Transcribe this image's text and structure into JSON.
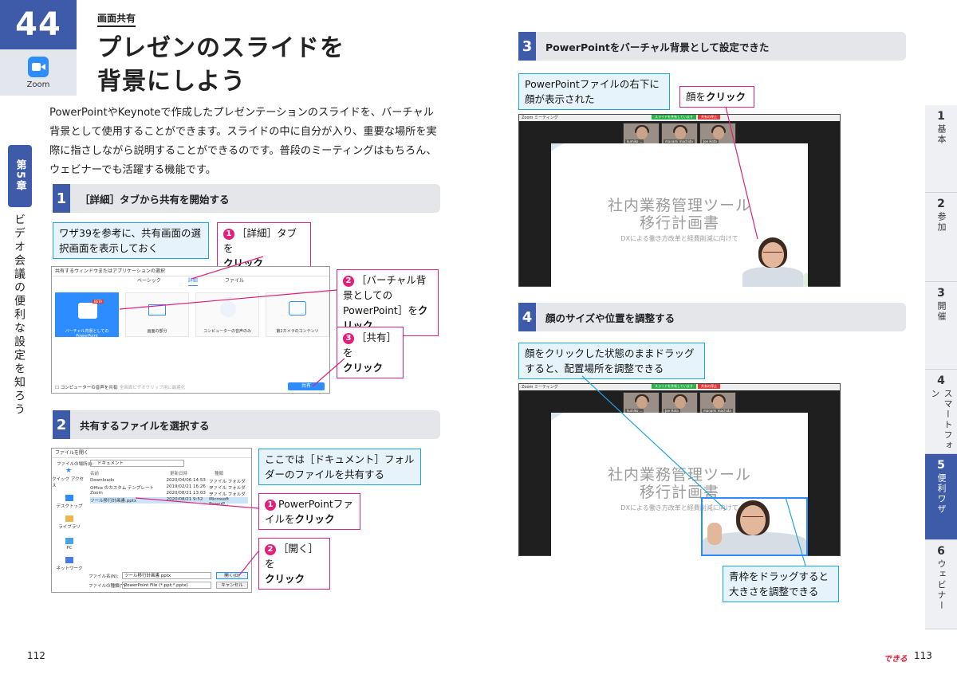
{
  "header": {
    "number": "44",
    "app_label": "Zoom",
    "category": "画面共有",
    "title_line1": "プレゼンのスライドを",
    "title_line2": "背景にしよう"
  },
  "intro": "PowerPointやKeynoteで作成したプレゼンテーションのスライドを、バーチャル背景として使用することができます。スライドの中に自分が入り、重要な場所を実際に指さしながら説明することができるのです。普段のミーティングはもちろん、ウェビナーでも活躍する機能です。",
  "chapter": {
    "tab": "第5章",
    "desc": "ビデオ会議の便利な設定を知ろう"
  },
  "steps": [
    {
      "n": "1",
      "title": "［詳細］タブから共有を開始する"
    },
    {
      "n": "2",
      "title": "共有するファイルを選択する"
    },
    {
      "n": "3",
      "title": "PowerPointをバーチャル背景として設定できた"
    },
    {
      "n": "4",
      "title": "顔のサイズや位置を調整する"
    }
  ],
  "step1": {
    "note": "ワザ39を参考に、共有画面の選択画面を表示しておく",
    "c1_prefix": "［詳細］タブを",
    "c1_action": "クリック",
    "c2_prefix": "［バーチャル背景としてのPowerPoint］を",
    "c2_action": "クリック",
    "c3_prefix": "［共有］を",
    "c3_action": "クリック",
    "dialog_title": "共有するウィンドウまたはアプリケーションの選択",
    "tabs": [
      "ベーシック",
      "詳細",
      "ファイル"
    ],
    "tiles": [
      "バーチャル背景としてのPowerPoint",
      "画面の部分",
      "コンピューターの音声のみ",
      "第2カメラのコンテンツ"
    ],
    "beta": "BETA",
    "audio_check": "コンピューターの音声を共有",
    "opt_check": "全画面ビデオクリップ用に最適化",
    "share_btn": "共有"
  },
  "step2": {
    "note": "ここでは［ドキュメント］フォルダーのファイルを共有する",
    "c1_prefix": "PowerPointファイルを",
    "c1_action": "クリック",
    "c2_prefix": "［開く］を",
    "c2_action": "クリック",
    "dialog_title": "ファイルを開く",
    "location_label": "ファイルの場所(I):",
    "location": "ドキュメント",
    "columns": [
      "名前",
      "更新日時",
      "種類"
    ],
    "sidebar": [
      "クイック アクセス",
      "デスクトップ",
      "ライブラリ",
      "PC",
      "ネットワーク"
    ],
    "rows": [
      {
        "name": "Downloads",
        "date": "2020/04/06 14:53",
        "type": "ファイル フォルダー"
      },
      {
        "name": "Office のカスタム テンプレート",
        "date": "2019/02/21 16:26",
        "type": "ファイル フォルダー"
      },
      {
        "name": "Zoom",
        "date": "2020/08/21 13:03",
        "type": "ファイル フォルダー"
      },
      {
        "name": "ツール移行計画書.pptx",
        "date": "2020/08/21 9:52",
        "type": "Microsoft PowerP..."
      }
    ],
    "filename_label": "ファイル名(N):",
    "filename": "ツール移行計画書.pptx",
    "filetype_label": "ファイルの種類(T):",
    "filetype": "PowerPoint File (*.ppt;*.pptx)",
    "open_btn": "開く(O)",
    "cancel_btn": "キャンセル"
  },
  "step3": {
    "note": "PowerPointファイルの右下に顔が表示された",
    "callout_prefix": "顔を",
    "callout_action": "クリック",
    "window_title": "Zoom ミーティング",
    "share_status": "スライドを共有しています",
    "stop_share": "共有の停止",
    "participants": [
      "kumiko ...",
      "manami machida",
      "Joe Hata"
    ],
    "slide_title1": "社内業務管理ツール",
    "slide_title2": "移行計画書",
    "slide_sub": "DXによる働き方改革と経費削減に向けて"
  },
  "step4": {
    "note": "顔をクリックした状態のままドラッグすると、配置場所を調整できる",
    "note2": "青枠をドラッグすると大きさを調整できる",
    "participants": [
      "kumiko ...",
      "Joe Hata",
      "manami machida"
    ]
  },
  "side_index": [
    {
      "d": "1",
      "w": "基本"
    },
    {
      "d": "2",
      "w": "参加"
    },
    {
      "d": "3",
      "w": "開催"
    },
    {
      "d": "4",
      "w": "スマートフォン"
    },
    {
      "d": "5",
      "w": "便利ワザ"
    },
    {
      "d": "6",
      "w": "ウェビナー"
    }
  ],
  "footer": {
    "left_page": "112",
    "right_page": "113",
    "brand": "できる"
  }
}
